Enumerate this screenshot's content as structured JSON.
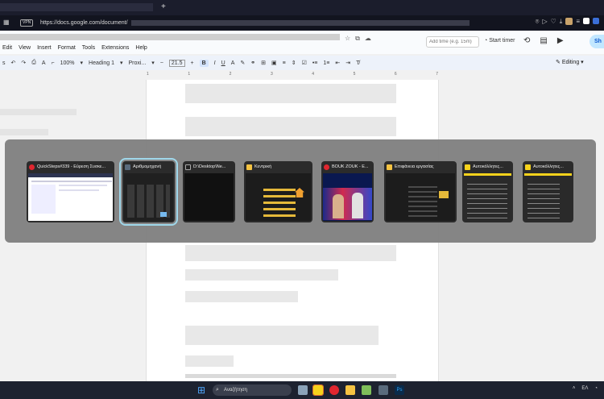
{
  "browser": {
    "new_tab_icon": "plus-icon",
    "vpn_label": "VPN",
    "url_prefix": "https://docs.google.com/document/",
    "right_icons": [
      "camera-icon",
      "play-icon",
      "heart-icon",
      "download-icon",
      "extensions-icon"
    ]
  },
  "docs": {
    "menu": [
      "Edit",
      "View",
      "Insert",
      "Format",
      "Tools",
      "Extensions",
      "Help"
    ],
    "time_placeholder": "Add time (e.g. 15m)",
    "start_timer": "Start timer",
    "share_label": "Sh",
    "toolbar": {
      "zoom": "100%",
      "style": "Heading 1",
      "font": "Proxi...",
      "font_size": "21.5",
      "bold": "B",
      "italic": "I",
      "underline": "U",
      "minus": "−",
      "plus": "+"
    },
    "mode": "Editing",
    "ruler_marks": [
      "1",
      "1",
      "2",
      "3",
      "4",
      "5",
      "6",
      "7"
    ]
  },
  "switcher": {
    "windows": [
      {
        "title": "QuickSteps#339 - Εύρεση Συσκε...",
        "icon": "opera-icon",
        "type": "browser"
      },
      {
        "title": "Αριθμομηχανή",
        "icon": "calculator-icon",
        "type": "calculator",
        "selected": true
      },
      {
        "title": "D:\\Desktop\\Ne...",
        "icon": "terminal-icon",
        "type": "terminal"
      },
      {
        "title": "Κεντρική",
        "icon": "folder-icon",
        "type": "explorer"
      },
      {
        "title": "BOUK ZOUK - E...",
        "icon": "opera-icon",
        "type": "video"
      },
      {
        "title": "Επιφάνεια εργασίας",
        "icon": "folder-icon",
        "type": "explorer"
      },
      {
        "title": "Αυτοκόλλητες...",
        "icon": "sticky-note-icon",
        "type": "note"
      },
      {
        "title": "Αυτοκόλλητες...",
        "icon": "sticky-note-icon",
        "type": "note"
      }
    ]
  },
  "taskbar": {
    "search_placeholder": "Αναζήτηση",
    "lang": "ΕΛ",
    "apps": [
      "file-explorer-icon",
      "sticky-notes-icon",
      "opera-icon",
      "folder-icon",
      "notepad-icon",
      "calculator-icon",
      "photoshop-icon"
    ]
  }
}
